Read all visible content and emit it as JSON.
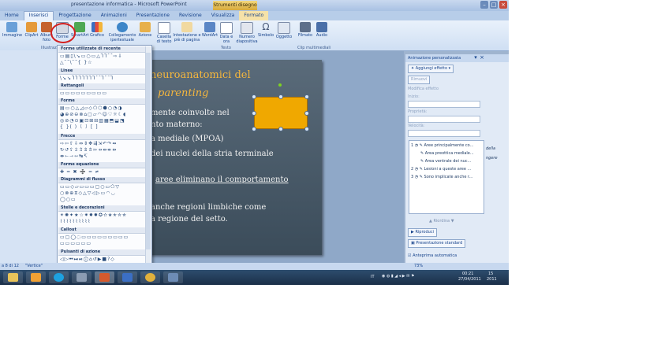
{
  "window": {
    "title": "presentazione informatica - Microsoft PowerPoint",
    "context_tab": "Strumenti disegno"
  },
  "tabs": [
    "Home",
    "Inserisci",
    "Progettazione",
    "Animazioni",
    "Presentazione",
    "Revisione",
    "Visualizza",
    "Formato"
  ],
  "ribbon": {
    "buttons": [
      "Immagine",
      "ClipArt",
      "Album foto",
      "Forme",
      "SmartArt",
      "Grafico",
      "Collegamento ipertestuale",
      "Azione",
      "Casella di testo",
      "Intestazione e piè di pagina",
      "WordArt",
      "Data e ora",
      "Numero diapositiva",
      "Simbolo",
      "Oggetto",
      "Filmato",
      "Audio"
    ],
    "groups": [
      "Illustrazioni",
      "Testo",
      "Clip multimediali"
    ]
  },
  "shapes_menu": {
    "sections": [
      "Forme utilizzate di recente",
      "Linee",
      "Rettangoli",
      "Forme",
      "Frecce",
      "Forme equazione",
      "Diagrammi di flusso",
      "Stelle e decorazioni",
      "Callout",
      "Pulsanti di azione"
    ]
  },
  "slide": {
    "title_line1": "neuroanatomici del",
    "title_line2": "parenting",
    "lines": [
      "mente coinvolte nel",
      "nto materno:",
      "a mediale (MPOA)",
      "dei nuclei della stria terminale",
      "aree eliminano il comportamento",
      "anche regioni limbiche come",
      "a regione del setto."
    ]
  },
  "anim_pane": {
    "title": "Animazione personalizzata",
    "add_effect": "Aggiungi effetto",
    "remove": "Rimuovi",
    "modify": "Modifica effetto",
    "fields": [
      "Inizio:",
      "Proprietà:",
      "Velocità:"
    ],
    "items": [
      {
        "num": "1",
        "text": "Aree principalmente co..."
      },
      {
        "num": "",
        "text": "Area preottica mediale..."
      },
      {
        "num": "",
        "text": "Area ventrale dei nuc..."
      },
      {
        "num": "2",
        "text": "Lesioni a queste aree ..."
      },
      {
        "num": "3",
        "text": "Sono implicate anche r..."
      }
    ],
    "reorder": "Riordina",
    "play": "Riproduci",
    "slideshow": "Presentazione standard",
    "autopreview": "Anteprima automatica",
    "right_text": [
      "della",
      "ngere"
    ]
  },
  "status": {
    "slide": "a 8 di 12",
    "theme": "\"Vertice\"",
    "zoom": "73%"
  },
  "taskbar": {
    "lang": "IT",
    "time": "00:21",
    "date": "27/04/2011",
    "time2": "15",
    "date2": "2011"
  }
}
